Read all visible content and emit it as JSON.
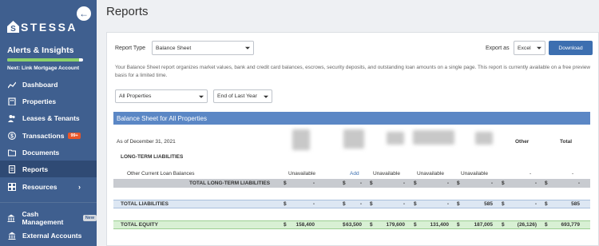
{
  "sidebar": {
    "collapse_icon": "back-arrow-icon",
    "logo_text": "STESSA",
    "alerts_title": "Alerts & Insights",
    "progress_fraction": 0.95,
    "next_text": "Next: Link Mortgage Account",
    "items": [
      {
        "label": "Dashboard",
        "icon": "chart-icon"
      },
      {
        "label": "Properties",
        "icon": "building-icon"
      },
      {
        "label": "Leases & Tenants",
        "icon": "people-icon"
      },
      {
        "label": "Transactions",
        "icon": "dollar-icon",
        "badge": "99+"
      },
      {
        "label": "Documents",
        "icon": "folder-icon"
      },
      {
        "label": "Reports",
        "icon": "document-icon"
      },
      {
        "label": "Resources",
        "icon": "grid-icon"
      },
      {
        "label": "Cash Management",
        "icon": "bank-icon",
        "badge": "New"
      },
      {
        "label": "External Accounts",
        "icon": "bank-icon"
      }
    ]
  },
  "page": {
    "title": "Reports"
  },
  "report": {
    "type_label": "Report Type",
    "type_value": "Balance Sheet",
    "export_label": "Export as",
    "export_value": "Excel",
    "download_label": "Download",
    "description": "Your Balance Sheet report organizes market values, bank and credit card balances, escrows, security deposits, and outstanding loan amounts on a single page. This report is currently available on a free preview basis for a limited time.",
    "filter_properties": "All Properties",
    "filter_period": "End of Last Year"
  },
  "sheet": {
    "header": "Balance Sheet for All Properties",
    "as_of": "As of December 31, 2021",
    "col_other": "Other",
    "col_total": "Total",
    "section_title": "LONG-TERM LIABILITIES",
    "loan_row": {
      "label": "Other Current Loan Balances",
      "values": [
        "Unavailable",
        "Add",
        "Unavailable",
        "Unavailable",
        "Unavailable",
        "-",
        "-"
      ]
    },
    "rows": [
      {
        "label": "TOTAL LONG-TERM LIABILITIES",
        "values": [
          "-",
          "-",
          "-",
          "-",
          "-",
          "-",
          "-"
        ]
      },
      {
        "label": "TOTAL LIABILITIES",
        "values": [
          "-",
          "-",
          "-",
          "-",
          "585",
          "-",
          "585"
        ]
      },
      {
        "label": "TOTAL EQUITY",
        "values": [
          "158,400",
          "63,500",
          "179,600",
          "131,400",
          "187,005",
          "(26,126)",
          "693,779"
        ]
      }
    ],
    "currency": "$"
  }
}
